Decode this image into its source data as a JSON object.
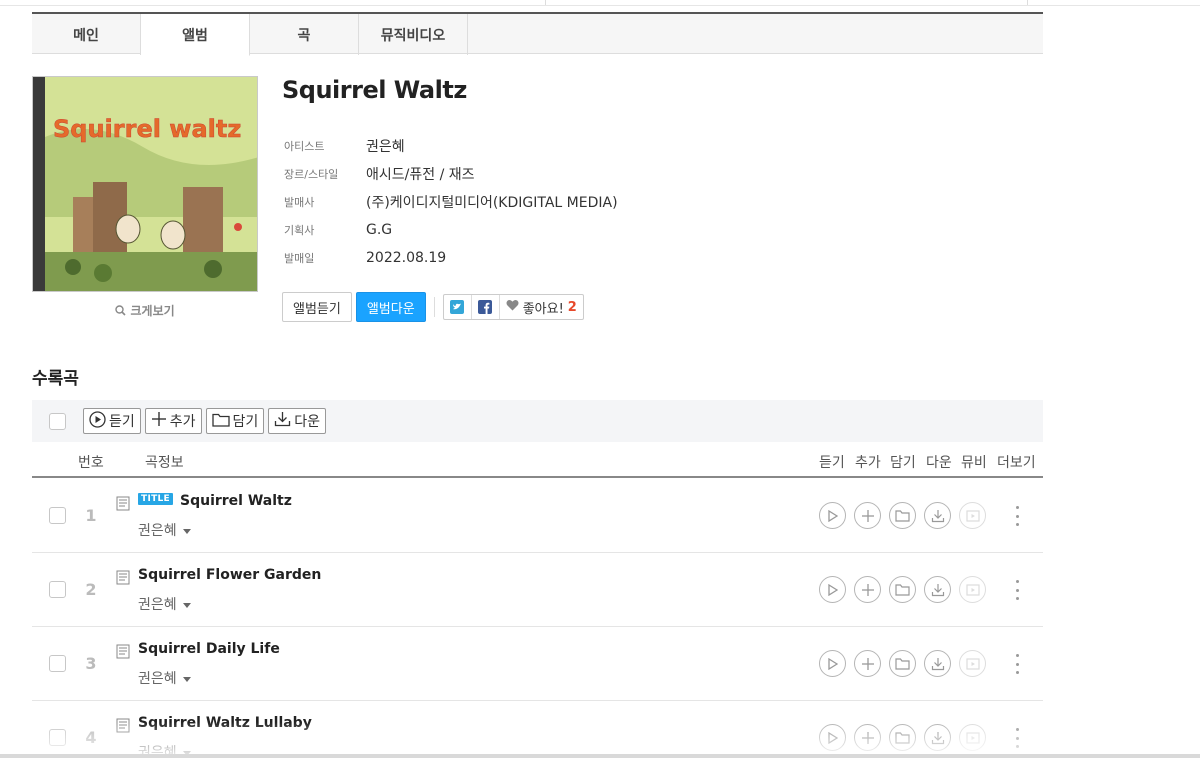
{
  "tabs": [
    "메인",
    "앨범",
    "곡",
    "뮤직비디오"
  ],
  "active_tab": "앨범",
  "album": {
    "title": "Squirrel Waltz",
    "cover_text": "Squirrel waltz",
    "zoom_label": "크게보기",
    "meta": [
      {
        "key": "아티스트",
        "value": "권은혜"
      },
      {
        "key": "장르/스타일",
        "value": "애시드/퓨전 / 재즈"
      },
      {
        "key": "발매사",
        "value": "(주)케이디지털미디어(KDIGITAL MEDIA)"
      },
      {
        "key": "기획사",
        "value": "G.G"
      },
      {
        "key": "발매일",
        "value": "2022.08.19"
      }
    ],
    "listen_btn": "앨범듣기",
    "download_btn": "앨범다운",
    "like_label": "좋아요!",
    "like_count": "2"
  },
  "tracklist": {
    "section_title": "수록곡",
    "toolbar": [
      "듣기",
      "추가",
      "담기",
      "다운"
    ],
    "col_number": "번호",
    "col_info": "곡정보",
    "col_actions": [
      "듣기",
      "추가",
      "담기",
      "다운",
      "뮤비",
      "더보기"
    ],
    "title_badge": "TITLE",
    "tracks": [
      {
        "num": "1",
        "title": "Squirrel Waltz",
        "artist": "권은혜",
        "is_title": true
      },
      {
        "num": "2",
        "title": "Squirrel Flower Garden",
        "artist": "권은혜",
        "is_title": false
      },
      {
        "num": "3",
        "title": "Squirrel Daily Life",
        "artist": "권은혜",
        "is_title": false
      },
      {
        "num": "4",
        "title": "Squirrel Waltz Lullaby",
        "artist": "권은혜",
        "is_title": false
      }
    ]
  },
  "colors": {
    "accent": "#1aa3ff",
    "badge": "#27a6e5",
    "like": "#e7492b"
  }
}
